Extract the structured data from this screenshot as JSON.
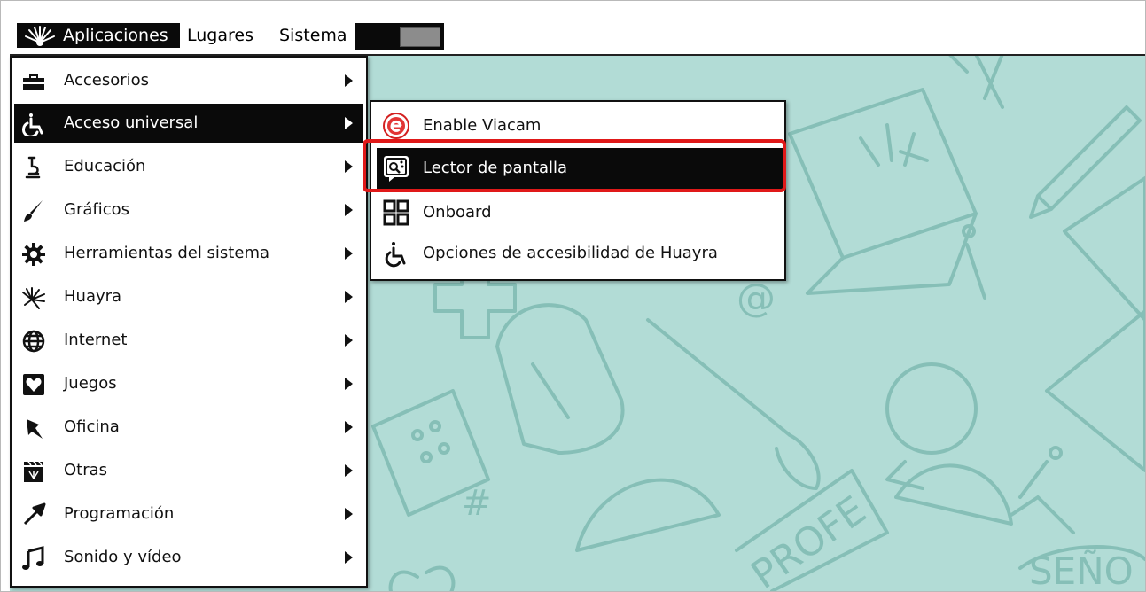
{
  "panel": {
    "applications_label": "Aplicaciones",
    "places_label": "Lugares",
    "system_label": "Sistema"
  },
  "menu": {
    "items": [
      {
        "label": "Accesorios",
        "icon": "toolbox-icon"
      },
      {
        "label": "Acceso universal",
        "icon": "accessibility-icon"
      },
      {
        "label": "Educación",
        "icon": "microscope-icon"
      },
      {
        "label": "Gráficos",
        "icon": "paintbrush-icon"
      },
      {
        "label": "Herramientas del sistema",
        "icon": "gear-icon"
      },
      {
        "label": "Huayra",
        "icon": "huayra-icon"
      },
      {
        "label": "Internet",
        "icon": "globe-icon"
      },
      {
        "label": "Juegos",
        "icon": "games-icon"
      },
      {
        "label": "Oficina",
        "icon": "pushpin-icon"
      },
      {
        "label": "Otras",
        "icon": "clapperboard-icon"
      },
      {
        "label": "Programación",
        "icon": "arrow-icon"
      },
      {
        "label": "Sonido y vídeo",
        "icon": "music-note-icon"
      }
    ],
    "active_index": 1
  },
  "submenu": {
    "items": [
      {
        "label": "Enable Viacam",
        "icon": "viacam-icon"
      },
      {
        "label": "Lector de pantalla",
        "icon": "screen-reader-icon"
      },
      {
        "label": "Onboard",
        "icon": "keyboard-grid-icon"
      },
      {
        "label": "Opciones de accesibilidad de Huayra",
        "icon": "wheelchair-icon"
      }
    ],
    "active_index": 1
  },
  "desktop": {
    "decor_at": "@",
    "decor_hash": "#",
    "decor_profe": "PROFE",
    "decor_seno": "SEÑO"
  },
  "colors": {
    "desktop_bg": "#b2dcd6",
    "highlight": "#e01919",
    "menu_active": "#0a0a0a"
  }
}
